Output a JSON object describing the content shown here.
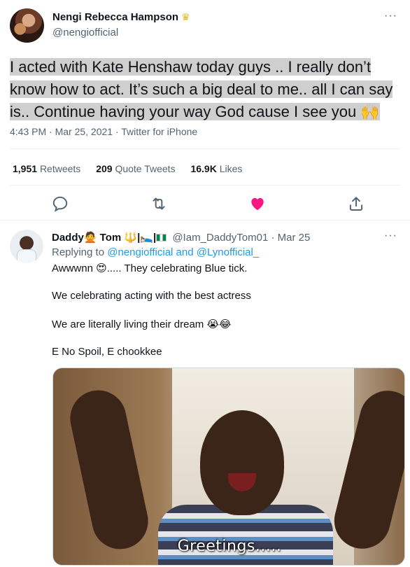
{
  "tweet": {
    "display_name": "Nengi Rebecca Hampson",
    "badge": "♛",
    "handle": "@nengiofficial",
    "more": "···",
    "text": "I acted with Kate Henshaw today guys .. I really don’t know how to act. It’s such a big deal to me.. all I can say is.. Continue having your way God cause I see you 🙌",
    "meta": "4:43 PM · Mar 25, 2021 · Twitter for iPhone",
    "stats": {
      "retweets_count": "1,951",
      "retweets_label": "Retweets",
      "quotes_count": "209",
      "quotes_label": "Quote Tweets",
      "likes_count": "16.9K",
      "likes_label": "Likes"
    },
    "actions": [
      "reply-icon",
      "retweet-icon",
      "like-icon",
      "share-icon"
    ],
    "like_color": "#f91880"
  },
  "reply": {
    "display_name": "Daddy🙅 Tom 🔱|🛌|",
    "handle": "@Iam_DaddyTom01 · Mar 25",
    "more": "···",
    "replying_prefix": "Replying to ",
    "replying_to": "@nengiofficial and @Lynofficial_",
    "lines": [
      "Awwwnn 😍..... They celebrating Blue tick.",
      "We celebrating acting with the best actress",
      "We are literally living their dream 😭😂",
      "E No Spoil, E chookkee"
    ],
    "media_caption": "Greetings....."
  }
}
